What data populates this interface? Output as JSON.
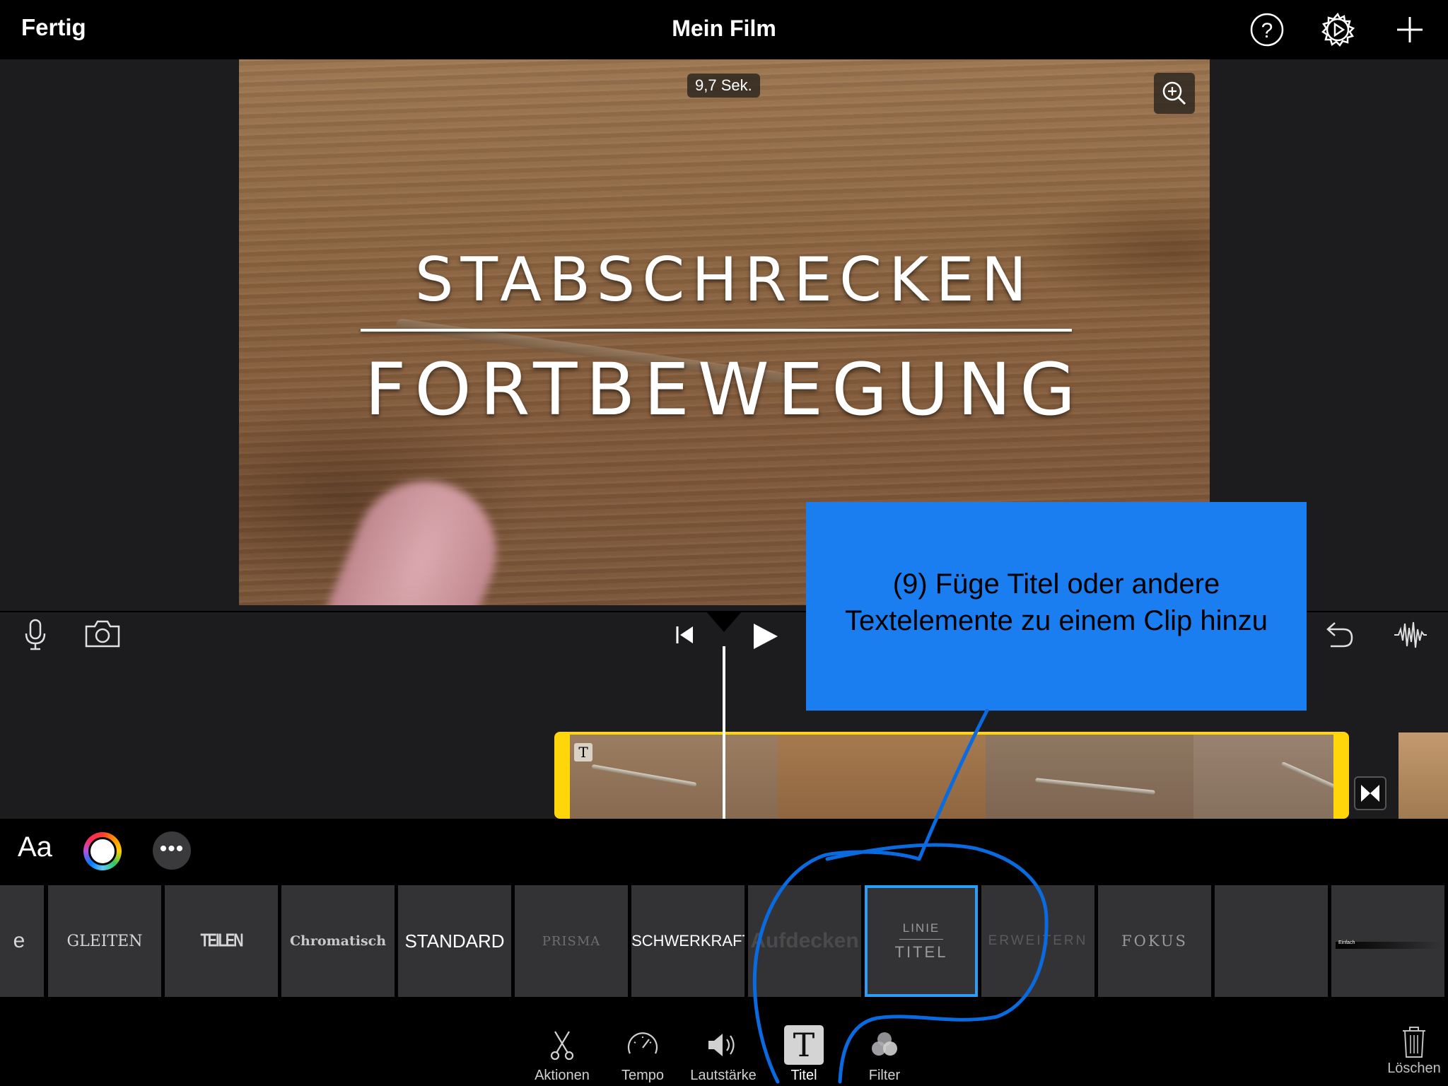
{
  "top_bar": {
    "done_label": "Fertig",
    "project_title": "Mein Film",
    "icons": [
      "help-icon",
      "settings-icon",
      "add-icon"
    ]
  },
  "viewer": {
    "duration_badge": "9,7 Sek.",
    "title_line_1": "STABSCHRECKEN",
    "title_line_2": "FORTBEWEGUNG",
    "icons": [
      "zoom-icon"
    ]
  },
  "timeline": {
    "icons": [
      "microphone-icon",
      "camera-icon",
      "skip-to-start-icon",
      "play-icon",
      "undo-icon",
      "audio-waveform-icon",
      "transition-icon"
    ],
    "clip_badge": "T"
  },
  "title_tray": {
    "font_button": "Aa",
    "styles": [
      {
        "label": "e"
      },
      {
        "label": "GLEITEN"
      },
      {
        "label": "TEILEN"
      },
      {
        "label": "Chromatisch"
      },
      {
        "label": "STANDARD"
      },
      {
        "label": "PRISMA"
      },
      {
        "label": "SCHWERKRAFT"
      },
      {
        "label": "Aufdecken"
      },
      {
        "label_top": "LINIE",
        "label_bottom": "TITEL",
        "selected": true
      },
      {
        "label": "ERWEITERN"
      },
      {
        "label": "FOKUS"
      },
      {
        "label": ""
      },
      {
        "label": "Einfach"
      }
    ]
  },
  "tab_bar": {
    "tabs": [
      {
        "label": "Aktionen",
        "icon": "scissors-icon"
      },
      {
        "label": "Tempo",
        "icon": "speedometer-icon"
      },
      {
        "label": "Lautstärke",
        "icon": "speaker-icon"
      },
      {
        "label": "Titel",
        "icon": "title-icon",
        "active": true
      },
      {
        "label": "Filter",
        "icon": "filter-icon"
      }
    ],
    "delete_label": "Löschen"
  },
  "annotation": {
    "callout_text_line_1": "(9) Füge Titel oder andere",
    "callout_text_line_2": "Textelemente zu einem Clip hinzu"
  },
  "colors": {
    "accent_blue": "#2a9df4",
    "callout_blue": "#1a7df0",
    "clip_border_yellow": "#ffd60a",
    "scribble_blue": "#0a6be0"
  }
}
